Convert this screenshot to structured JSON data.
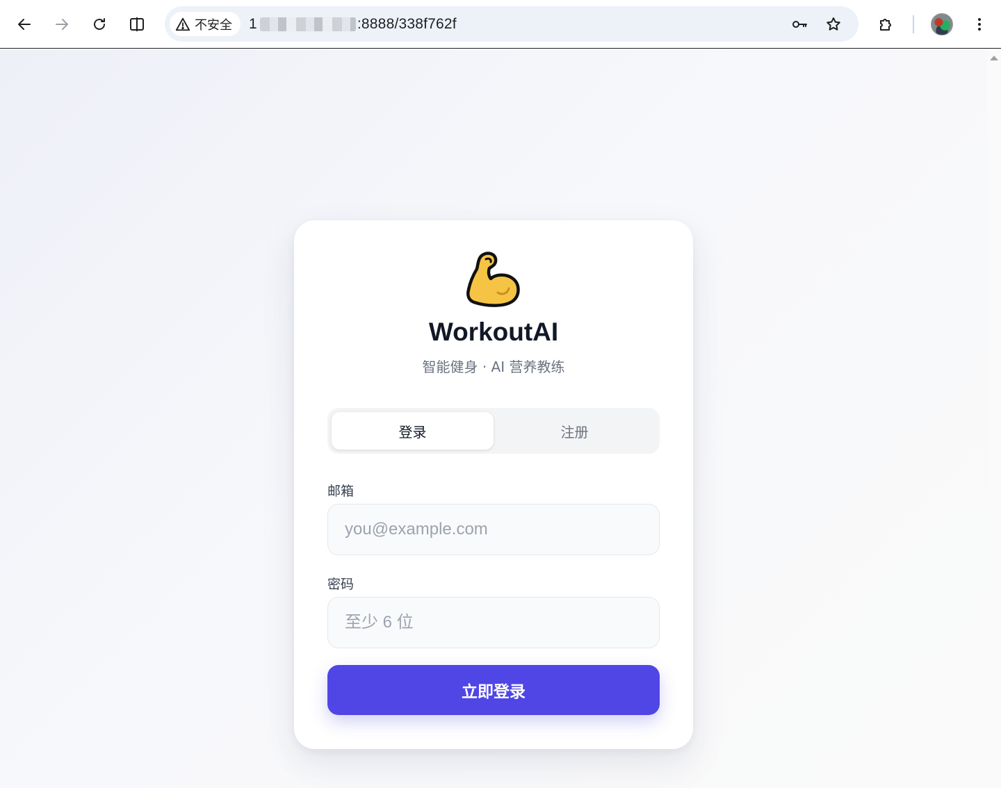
{
  "browser": {
    "security_label": "不安全",
    "url_prefix": "1",
    "url_suffix": ":8888/338f762f"
  },
  "app": {
    "logo_icon": "flexed-biceps-icon",
    "brand": "WorkoutAI",
    "tagline": "智能健身 · AI 营养教练"
  },
  "tabs": {
    "login": "登录",
    "register": "注册"
  },
  "form": {
    "email_label": "邮箱",
    "email_placeholder": "you@example.com",
    "password_label": "密码",
    "password_placeholder": "至少 6 位",
    "submit_label": "立即登录"
  },
  "colors": {
    "primary": "#4f46e5",
    "brand_text": "#111827",
    "muted_text": "#6b7280"
  }
}
